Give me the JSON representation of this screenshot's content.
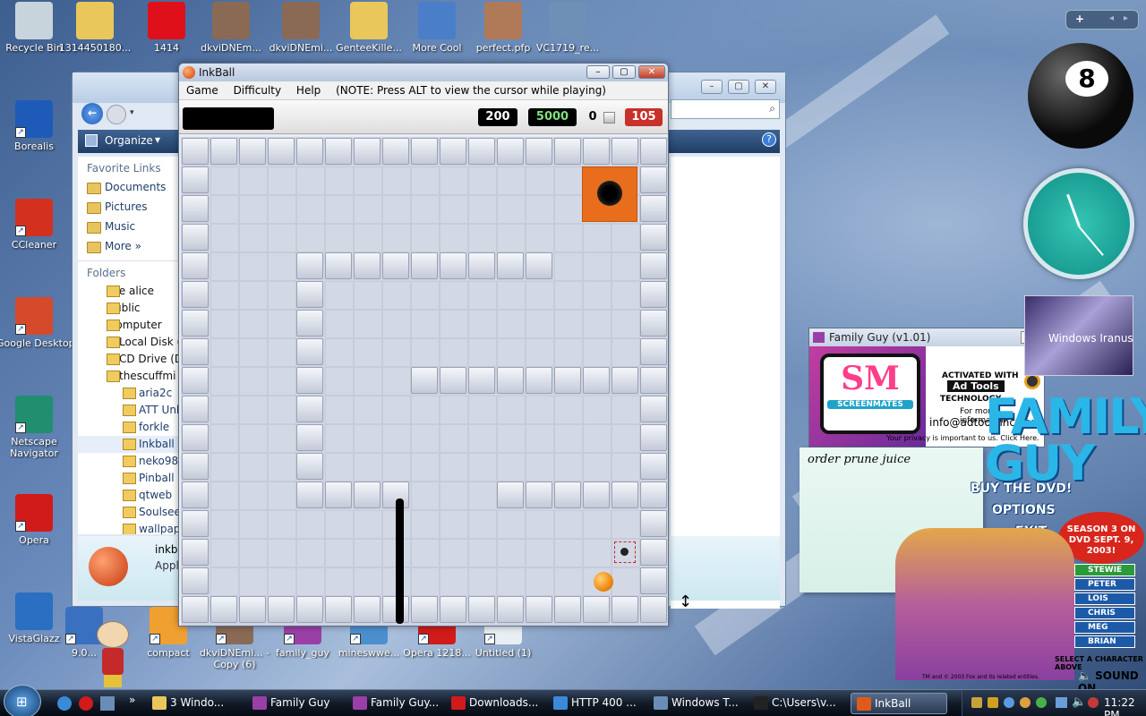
{
  "desktop_icons": [
    {
      "label": "Recycle Bin",
      "icon": "recycle-bin-icon",
      "color": "#c8d4dc"
    },
    {
      "label": "1314450180...",
      "icon": "folder-icon",
      "color": "#e9c75b"
    },
    {
      "label": "1414",
      "icon": "paint-splat-icon",
      "color": "#e0101a"
    },
    {
      "label": "dkviDNEm...",
      "icon": "video-thumbnail-icon",
      "color": "#8a6a55"
    },
    {
      "label": "dkviDNEmi...",
      "icon": "video-thumbnail-icon",
      "color": "#8a6a55"
    },
    {
      "label": "GenteeKille...",
      "icon": "zip-folder-icon",
      "color": "#e9c75b"
    },
    {
      "label": "More Cool",
      "icon": "3d-shortcut-icon",
      "color": "#4a7ec8"
    },
    {
      "label": "perfect.pfp",
      "icon": "photo-icon",
      "color": "#b07a58"
    },
    {
      "label": "VC1719_re...",
      "icon": "setup-icon",
      "color": "#6e8fb6"
    },
    {
      "label": "Borealis",
      "icon": "globe-icon",
      "color": "#1e5bb8"
    },
    {
      "label": "CCleaner",
      "icon": "ccleaner-icon",
      "color": "#d4301f"
    },
    {
      "label": "Google Desktop",
      "icon": "google-desktop-icon",
      "color": "#d44a2a"
    },
    {
      "label": "Netscape Navigator",
      "icon": "netscape-icon",
      "color": "#1f8f6f"
    },
    {
      "label": "Opera",
      "icon": "opera-icon",
      "color": "#d11a1a"
    },
    {
      "label": "VistaGlazz",
      "icon": "vistaglazz-icon",
      "color": "#2a6fc1"
    },
    {
      "label": "9.0...",
      "icon": "media-icon",
      "color": "#3a70c0"
    },
    {
      "label": "compact",
      "icon": "compact-icon",
      "color": "#f0a030"
    },
    {
      "label": "dkviDNEmi... - Copy (6)",
      "icon": "video-thumbnail-icon",
      "color": "#8a6a55"
    },
    {
      "label": "family_guy",
      "icon": "family-guy-icon",
      "color": "#9b3fa8"
    },
    {
      "label": "mineswwe...",
      "icon": "minesweeper-icon",
      "color": "#4b8fcf"
    },
    {
      "label": "Opera 1218...",
      "icon": "opera-icon",
      "color": "#d11a1a"
    },
    {
      "label": "Untitled (1)",
      "icon": "document-icon",
      "color": "#e9eef5"
    }
  ],
  "explorer": {
    "organize": "Organize",
    "favorite_links_header": "Favorite Links",
    "favorites": [
      "Documents",
      "Pictures",
      "Music",
      "More"
    ],
    "folders_header": "Folders",
    "tree_top": [
      "fpe alice",
      "Public",
      "Computer",
      "Local Disk (",
      "CD Drive (D",
      "thescuffmi"
    ],
    "tree_sub": [
      "aria2c",
      "ATT Unlin",
      "forkle",
      "Inkball",
      "neko98",
      "Pinball",
      "qtweb",
      "SoulseekC",
      "wallpaper"
    ],
    "details_name": "inkba",
    "details_type": "Appli"
  },
  "inkball": {
    "title": "InkBall",
    "menu": [
      "Game",
      "Difficulty",
      "Help"
    ],
    "menu_note": "(NOTE: Press ALT to view the cursor while playing)",
    "score": "200",
    "bonus": "5000",
    "ink_count": "0",
    "timer": "105",
    "colors": {
      "score_bg": "#000000",
      "bonus_text": "#7fe07f",
      "timer_bg": "#c8302a"
    }
  },
  "family_guy_window": {
    "title": "Family Guy (v1.01)",
    "logo_text": "SM",
    "logo_sub": "SCREENMATES",
    "activated": "ACTIVATED WITH",
    "adtools": "Ad Tools",
    "technology": "TECHNOLOGY",
    "more_info": "For more information:",
    "email": "info@adtoolsinc.com",
    "privacy": "Your privacy is important to us. Click Here."
  },
  "sticky_note": "order prune juice",
  "family_guy_panel": {
    "logo": "FAMILY GUY",
    "menu": [
      "BUY THE DVD!",
      "OPTIONS",
      "EXIT"
    ],
    "season": "SEASON 3 ON DVD SEPT. 9, 2003!",
    "characters": [
      "STEWIE",
      "PETER",
      "LOIS",
      "CHRIS",
      "MEG",
      "BRIAN"
    ],
    "select_hint": "SELECT A CHARACTER ABOVE",
    "sound": "SOUND ON",
    "copyright": "TM and © 2003 Fox and its related entities."
  },
  "gadget_text": "Windows Iranus",
  "taskbar": {
    "tasks": [
      {
        "label": "3 Windo...",
        "icon": "folder-icon",
        "color": "#e9c75b"
      },
      {
        "label": "Family Guy",
        "icon": "family-guy-icon",
        "color": "#9b3fa8"
      },
      {
        "label": "Family Guy...",
        "icon": "family-guy-icon",
        "color": "#9b3fa8"
      },
      {
        "label": "Downloads...",
        "icon": "opera-icon",
        "color": "#d11a1a"
      },
      {
        "label": "HTTP 400 ...",
        "icon": "browser-icon",
        "color": "#3b8ad8"
      },
      {
        "label": "Windows T...",
        "icon": "task-manager-icon",
        "color": "#6a8db8"
      },
      {
        "label": "C:\\Users\\v...",
        "icon": "cmd-icon",
        "color": "#222222"
      },
      {
        "label": "InkBall",
        "icon": "inkball-icon",
        "color": "#e05a1a"
      }
    ],
    "clock": "11:22 PM"
  }
}
